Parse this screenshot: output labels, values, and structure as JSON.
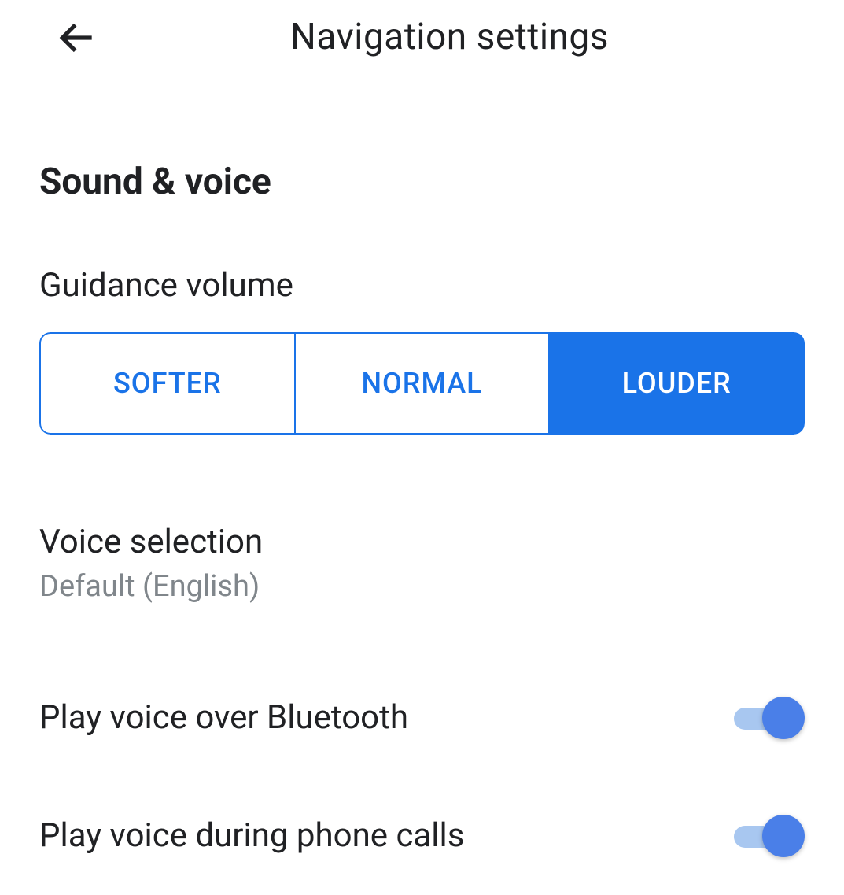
{
  "header": {
    "title": "Navigation settings"
  },
  "section": {
    "heading": "Sound & voice"
  },
  "guidance_volume": {
    "label": "Guidance volume",
    "options": {
      "softer": "SOFTER",
      "normal": "NORMAL",
      "louder": "LOUDER"
    },
    "selected": "louder"
  },
  "voice_selection": {
    "title": "Voice selection",
    "subtitle": "Default (English)"
  },
  "switches": {
    "bluetooth": {
      "label": "Play voice over Bluetooth",
      "on": true
    },
    "phone_calls": {
      "label": "Play voice during phone calls",
      "on": true
    }
  }
}
